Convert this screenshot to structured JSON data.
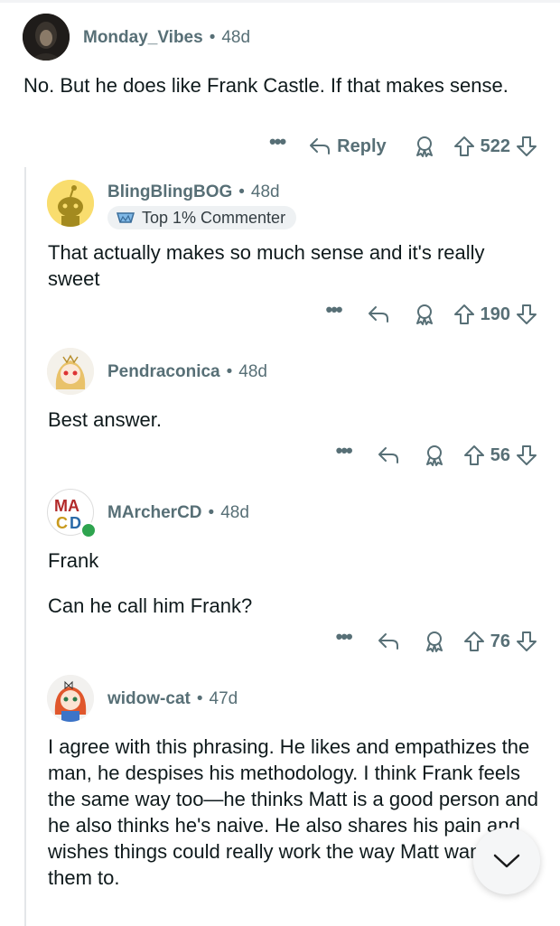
{
  "comments": [
    {
      "username": "Monday_Vibes",
      "age": "48d",
      "body": "No. But he does like Frank Castle. If that makes sense.",
      "reply_label": "Reply",
      "votes": "522"
    },
    {
      "username": "BlingBlingBOG",
      "age": "48d",
      "badge": "Top 1% Commenter",
      "body": "That actually makes so much sense and it's really sweet",
      "votes": "190"
    },
    {
      "username": "Pendraconica",
      "age": "48d",
      "body": "Best answer.",
      "votes": "56"
    },
    {
      "username": "MArcherCD",
      "age": "48d",
      "body_lines": [
        "Frank",
        "Can he call him Frank?"
      ],
      "votes": "76",
      "online_color": "#2ea44f"
    },
    {
      "username": "widow-cat",
      "age": "47d",
      "body": "I agree with this phrasing. He likes and empathizes the man, he despises his methodology. I think Frank feels the same way too—he thinks Matt is a good person and he also thinks he's naive. He also shares his pain and wishes things could really work the way Matt wants them to."
    }
  ],
  "separator": "•",
  "more_glyph": "•••",
  "icons": [
    "overflow-menu-icon",
    "reply-icon",
    "award-icon",
    "upvote-icon",
    "downvote-icon",
    "chevron-down-icon"
  ]
}
